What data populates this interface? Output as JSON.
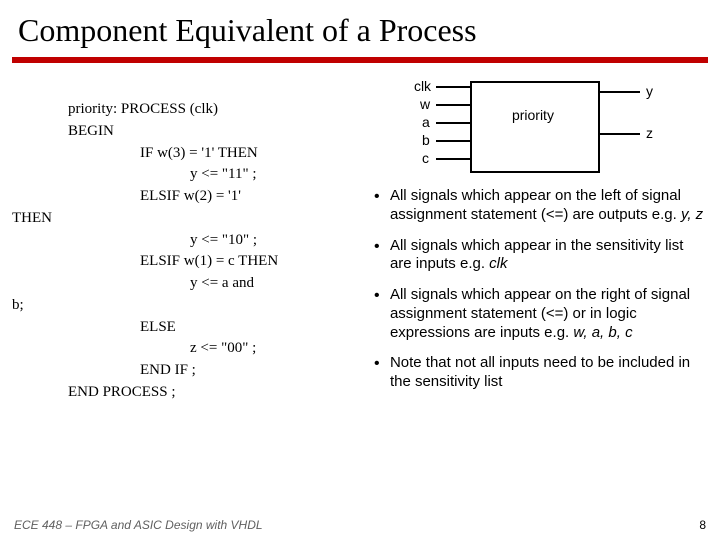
{
  "title": "Component Equivalent of a Process",
  "code": {
    "l1": "priority: PROCESS (clk)",
    "l2": "BEGIN",
    "l3": "IF w(3) = '1' THEN",
    "l4": "y <= \"11\" ;",
    "l5": "ELSIF w(2) = '1'",
    "l6": "THEN",
    "l7": "y <= \"10\" ;",
    "l8": "ELSIF w(1) = c THEN",
    "l9": "y <= a and",
    "l10": "b;",
    "l11": "ELSE",
    "l12": "z <= \"00\" ;",
    "l13": "END IF ;",
    "l14": "END PROCESS ;"
  },
  "diagram": {
    "block": "priority",
    "inputs": [
      "clk",
      "w",
      "a",
      "b",
      "c"
    ],
    "outputs": [
      "y",
      "z"
    ]
  },
  "bullets": [
    {
      "text_a": "All signals which appear on the left of signal assignment statement (<=) are outputs e.g. ",
      "em": "y, z"
    },
    {
      "text_a": "All signals which appear in the sensitivity list are inputs e.g. ",
      "em": "clk"
    },
    {
      "text_a": "All signals which appear on the right of signal assignment statement (<=) or in logic expressions are inputs e.g. ",
      "em": "w, a, b, c"
    },
    {
      "text_a": "Note that not all inputs need to be included in the sensitivity list",
      "em": ""
    }
  ],
  "footer": {
    "course": "ECE 448 – FPGA and ASIC Design with VHDL",
    "page": "8"
  }
}
